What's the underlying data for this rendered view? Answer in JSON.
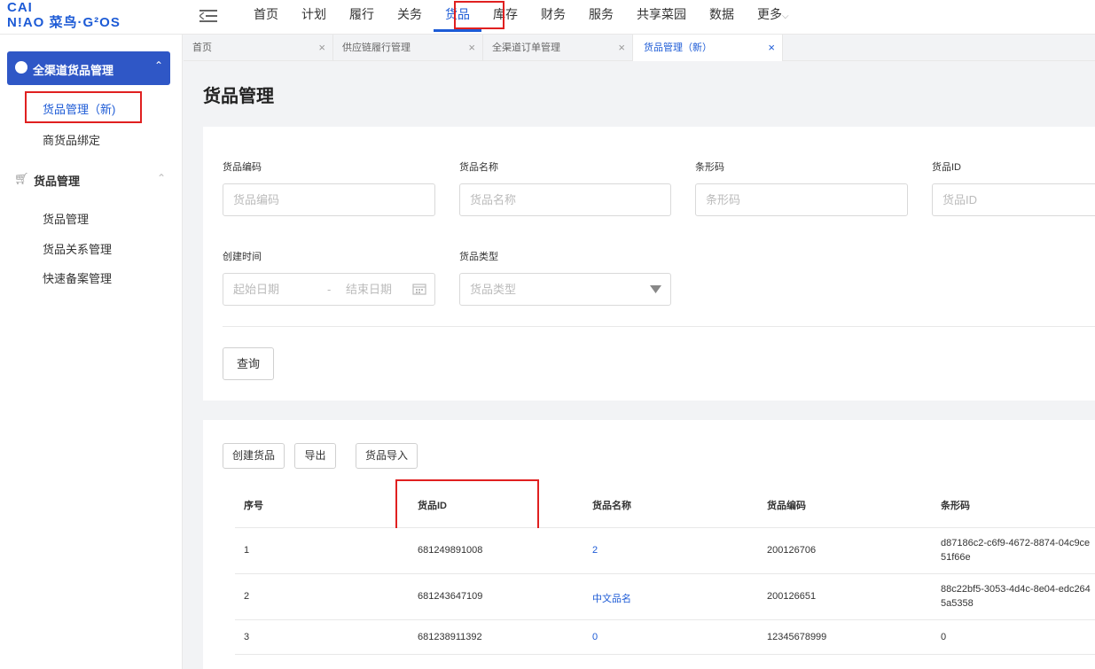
{
  "logo": {
    "line1": "CAI",
    "line2": "N!AO 菜鸟·G²OS"
  },
  "nav": {
    "items": [
      "首页",
      "计划",
      "履行",
      "关务",
      "货品",
      "库存",
      "财务",
      "服务",
      "共享菜园",
      "数据",
      "更多"
    ],
    "active_index": 4,
    "more_caret": "⌵"
  },
  "sidebar": {
    "group1_label": "全渠道货品管理",
    "group1_items": [
      "货品管理（新)",
      "商货品绑定"
    ],
    "group2_label": "货品管理",
    "group2_items": [
      "货品管理",
      "货品关系管理",
      "快速备案管理"
    ],
    "collapse_glyph": "⌃"
  },
  "tabs": [
    {
      "label": "首页",
      "close": "×"
    },
    {
      "label": "供应链履行管理",
      "close": "×"
    },
    {
      "label": "全渠道订单管理",
      "close": "×"
    },
    {
      "label": "货品管理（新）",
      "close": "×"
    }
  ],
  "page_title": "货品管理",
  "filters": {
    "code_label": "货品编码",
    "code_placeholder": "货品编码",
    "name_label": "货品名称",
    "name_placeholder": "货品名称",
    "barcode_label": "条形码",
    "barcode_placeholder": "条形码",
    "id_label": "货品ID",
    "id_placeholder": "货品ID",
    "created_label": "创建时间",
    "start_placeholder": "起始日期",
    "date_sep": "-",
    "end_placeholder": "结束日期",
    "type_label": "货品类型",
    "type_placeholder": "货品类型"
  },
  "buttons": {
    "query": "查询",
    "create": "创建货品",
    "export": "导出",
    "import": "货品导入"
  },
  "table": {
    "columns": [
      "序号",
      "货品ID",
      "货品名称",
      "货品编码",
      "条形码"
    ],
    "rows": [
      {
        "no": "1",
        "id": "681249891008",
        "name": "2",
        "code": "200126706",
        "barcode": "d87186c2-c6f9-4672-8874-04c9ce51f66e"
      },
      {
        "no": "2",
        "id": "681243647109",
        "name": "中文品名",
        "code": "200126651",
        "barcode": "88c22bf5-3053-4d4c-8e04-edc2645a5358"
      },
      {
        "no": "3",
        "id": "681238911392",
        "name": "0",
        "code": "12345678999",
        "barcode": "0"
      }
    ]
  },
  "colors": {
    "accent": "#1d5bd6",
    "highlight": "#e02020"
  }
}
